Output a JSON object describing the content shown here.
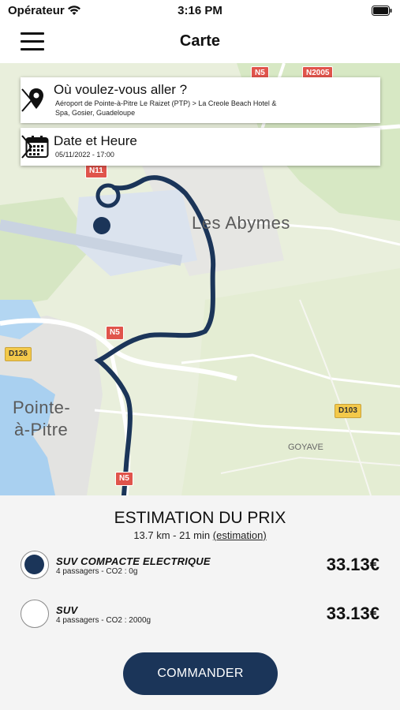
{
  "status_bar": {
    "carrier": "Opérateur",
    "time": "3:16 PM"
  },
  "nav": {
    "title": "Carte"
  },
  "map": {
    "labels": {
      "city_1": "Les Abymes",
      "city_2_line1": "Pointe-",
      "city_2_line2": "à-Pitre",
      "locality": "GOYAVE"
    },
    "road_badges": [
      "N5",
      "N2005",
      "N11",
      "N5",
      "D126",
      "D103",
      "N5"
    ],
    "destination_card": {
      "title": "Où voulez-vous aller ?",
      "subtitle": "Aéroport de Pointe-à-Pitre Le Raizet (PTP) > La Creole Beach Hotel & Spa, Gosier, Guadeloupe"
    },
    "date_card": {
      "title": "Date et Heure",
      "subtitle": "05/11/2022 - 17:00"
    },
    "colors": {
      "route": "#1b3559"
    }
  },
  "estimate": {
    "title": "ESTIMATION DU PRIX",
    "distance_time": "13.7 km - 21 min",
    "estimation_link": "(estimation)"
  },
  "vehicles": [
    {
      "name": "SUV COMPACTE ELECTRIQUE",
      "details": "4 passagers - CO2 : 0g",
      "price": "33.13€",
      "selected": true
    },
    {
      "name": "SUV",
      "details": "4 passagers - CO2 : 2000g",
      "price": "33.13€",
      "selected": false
    }
  ],
  "actions": {
    "order_label": "COMMANDER"
  },
  "theme": {
    "accent": "#1b3559",
    "panel_bg": "#f4f4f4"
  }
}
